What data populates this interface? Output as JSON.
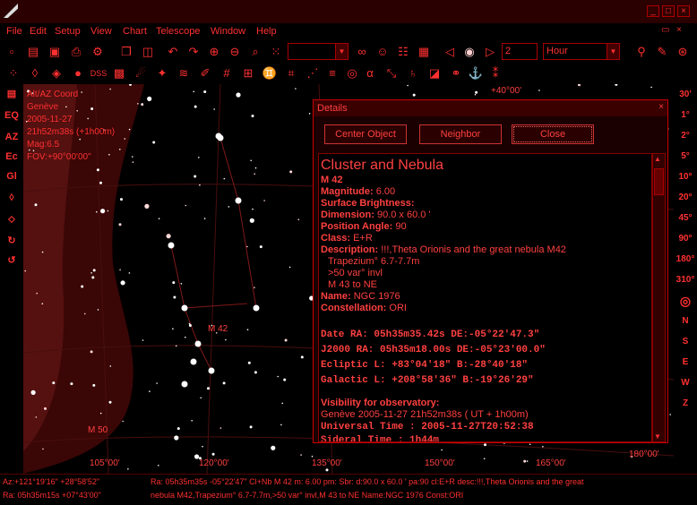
{
  "menu": [
    "File",
    "Edit",
    "Setup",
    "View",
    "Chart",
    "Telescope",
    "Window",
    "Help"
  ],
  "toolbar": {
    "time_step": "2",
    "time_unit": "Hour",
    "dss_label": "DSS",
    "alpha_label": "α"
  },
  "left_tools": [
    "EQ",
    "AZ",
    "Ec",
    "Gl"
  ],
  "right_tools": [
    "30'",
    "1°",
    "2°",
    "5°",
    "10°",
    "20°",
    "45°",
    "90°",
    "180°",
    "310°",
    "N",
    "S",
    "E",
    "W",
    "Z"
  ],
  "sky_info": {
    "coord": "Alt/AZ Coord",
    "place": "Genève",
    "date": "2005-11-27",
    "time": "21h52m38s (+1h00m)",
    "mag": "Mag:6.5",
    "fov": "FOV:+90°00'00\""
  },
  "sky_labels": {
    "m42": "M 42",
    "m50": "M 50",
    "ra_ticks": [
      "105°00'",
      "120°00'",
      "135°00'",
      "150°00'",
      "165°00'",
      "180°00'"
    ],
    "top_tick": "+40°00'"
  },
  "details": {
    "title": "Details",
    "buttons": {
      "center": "Center Object",
      "neighbor": "Neighbor",
      "close": "Close"
    },
    "heading": "Cluster and Nebula",
    "name": "M  42",
    "magnitude_label": "Magnitude:",
    "magnitude": "6.00",
    "surface_label": "Surface Brightness:",
    "dimension_label": "Dimension:",
    "dimension": "90.0 x 60.0 '",
    "pa_label": "Position Angle:",
    "pa": "90",
    "class_label": "Class:",
    "class": "E+R",
    "desc_label": "Description:",
    "desc": "!!!,Theta Orionis and the great nebula M42",
    "desc2": "Trapezium° 6.7-7.7m",
    "desc3": ">50 var° invl",
    "desc4": "M 43 to NE",
    "cat_label": "Name:",
    "cat": "NGC 1976",
    "const_label": "Constellation:",
    "const": "ORI",
    "date_ra": "Date RA:  05h35m35.42s  DE:-05°22'47.3\"",
    "j2000": "J2000 RA:  05h35m18.00s  DE:-05°23'00.0\"",
    "ecliptic": "Ecliptic  L: +83°04'18\"  B:-28°40'18\"",
    "galactic": "Galactic  L: +208°58'36\"  B:-19°26'29\"",
    "vis_label": "Visibility for observatory:",
    "vis_place": "Genève 2005-11-27 21h52m38s ( UT +  1h00m)",
    "ut": "Universal Time   :  2005-11-27T20:52:38",
    "sidereal": "Sideral Time    :  1h44m"
  },
  "status": {
    "l1": "Az:+121°19'16\" +28°58'52\"",
    "l2": "Ra: 05h35m15s +07°43'00\"",
    "r1": "Ra: 05h35m35s  -05°22'47\" Cl+Nb M 42 m: 6.00 pm: Sbr: d:90.0 x 60.0 ' pa:90 cl:E+R desc:!!!,Theta Orionis and the great",
    "r2": "nebula M42,Trapezium° 6.7-7.7m,>50 var° invl,M 43 to NE Name:NGC 1976 Const:ORI"
  },
  "colors": {
    "accent": "#ff3030",
    "panel": "#1a0000",
    "border": "#cc0000"
  }
}
